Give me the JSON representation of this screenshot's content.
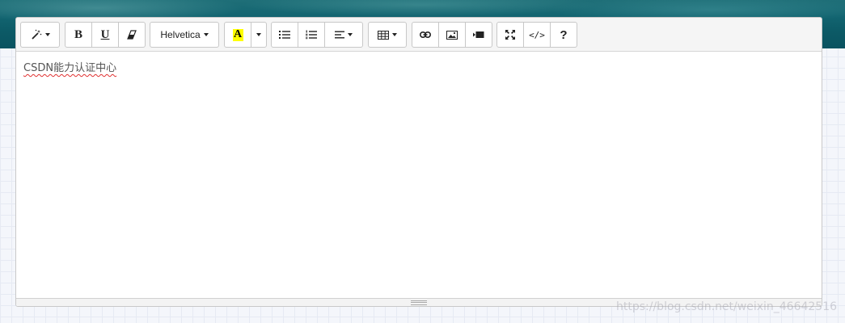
{
  "toolbar": {
    "style_icon": "magic-wand-icon",
    "bold_label": "B",
    "underline_label": "U",
    "clear_icon": "eraser-icon",
    "font_name": "Helvetica",
    "highlight_label": "A",
    "highlight_color": "#ffff00",
    "unordered_list_icon": "bulleted-list-icon",
    "ordered_list_icon": "numbered-list-icon",
    "paragraph_icon": "align-left-icon",
    "table_icon": "table-grid-icon",
    "link_icon": "link-icon",
    "picture_icon": "image-icon",
    "video_icon": "video-icon",
    "fullscreen_icon": "expand-icon",
    "codeview_label": "</>",
    "help_label": "?"
  },
  "editor": {
    "content": "CSDN能力认证中心"
  },
  "watermark": "https://blog.csdn.net/weixin_46642516",
  "colors": {
    "toolbar_bg": "#f5f5f5",
    "border": "#c8c8c8",
    "spellcheck": "#e03030"
  }
}
